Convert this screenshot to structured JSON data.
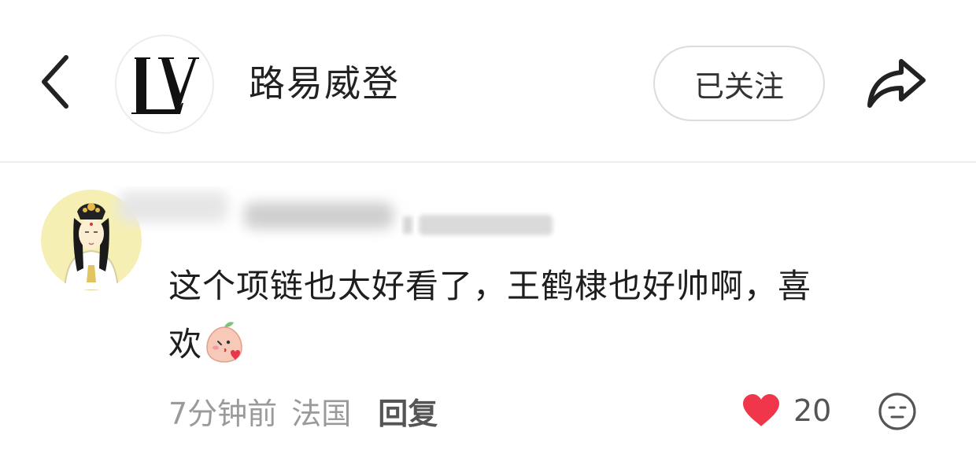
{
  "header": {
    "back_icon": "chevron-left-icon",
    "brand_logo_text": "LV",
    "brand_name": "路易威登",
    "follow_label": "已关注",
    "share_icon": "share-arrow-icon"
  },
  "comment": {
    "avatar": "guanyin-avatar",
    "text_line1": "这个项链也太好看了，王鹤棣也好帅啊，喜",
    "text_line2": "欢",
    "emoji": "peach-kiss-emoji",
    "time": "7分钟前",
    "location": "法国",
    "reply_label": "回复",
    "like_icon": "heart-icon",
    "like_color": "#f0364a",
    "like_count": "20",
    "reaction_icon": "face-icon"
  }
}
